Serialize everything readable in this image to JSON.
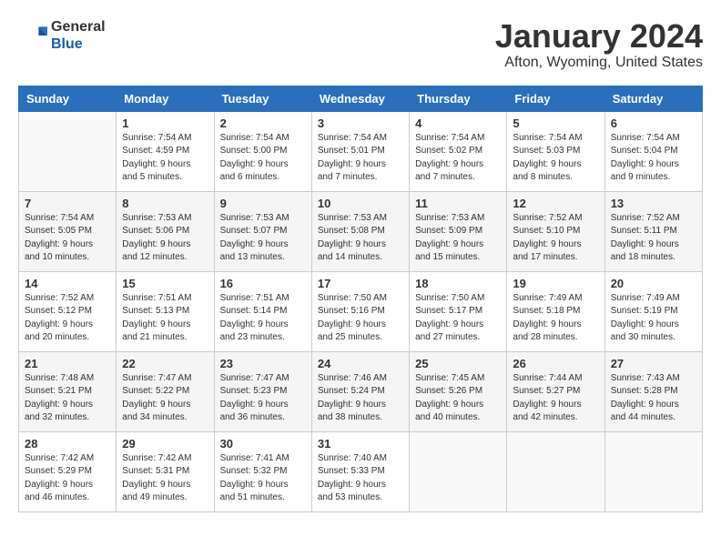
{
  "logo": {
    "line1": "General",
    "line2": "Blue"
  },
  "title": "January 2024",
  "location": "Afton, Wyoming, United States",
  "weekdays": [
    "Sunday",
    "Monday",
    "Tuesday",
    "Wednesday",
    "Thursday",
    "Friday",
    "Saturday"
  ],
  "weeks": [
    [
      {
        "day": "",
        "detail": ""
      },
      {
        "day": "1",
        "detail": "Sunrise: 7:54 AM\nSunset: 4:59 PM\nDaylight: 9 hours\nand 5 minutes."
      },
      {
        "day": "2",
        "detail": "Sunrise: 7:54 AM\nSunset: 5:00 PM\nDaylight: 9 hours\nand 6 minutes."
      },
      {
        "day": "3",
        "detail": "Sunrise: 7:54 AM\nSunset: 5:01 PM\nDaylight: 9 hours\nand 7 minutes."
      },
      {
        "day": "4",
        "detail": "Sunrise: 7:54 AM\nSunset: 5:02 PM\nDaylight: 9 hours\nand 7 minutes."
      },
      {
        "day": "5",
        "detail": "Sunrise: 7:54 AM\nSunset: 5:03 PM\nDaylight: 9 hours\nand 8 minutes."
      },
      {
        "day": "6",
        "detail": "Sunrise: 7:54 AM\nSunset: 5:04 PM\nDaylight: 9 hours\nand 9 minutes."
      }
    ],
    [
      {
        "day": "7",
        "detail": "Sunrise: 7:54 AM\nSunset: 5:05 PM\nDaylight: 9 hours\nand 10 minutes."
      },
      {
        "day": "8",
        "detail": "Sunrise: 7:53 AM\nSunset: 5:06 PM\nDaylight: 9 hours\nand 12 minutes."
      },
      {
        "day": "9",
        "detail": "Sunrise: 7:53 AM\nSunset: 5:07 PM\nDaylight: 9 hours\nand 13 minutes."
      },
      {
        "day": "10",
        "detail": "Sunrise: 7:53 AM\nSunset: 5:08 PM\nDaylight: 9 hours\nand 14 minutes."
      },
      {
        "day": "11",
        "detail": "Sunrise: 7:53 AM\nSunset: 5:09 PM\nDaylight: 9 hours\nand 15 minutes."
      },
      {
        "day": "12",
        "detail": "Sunrise: 7:52 AM\nSunset: 5:10 PM\nDaylight: 9 hours\nand 17 minutes."
      },
      {
        "day": "13",
        "detail": "Sunrise: 7:52 AM\nSunset: 5:11 PM\nDaylight: 9 hours\nand 18 minutes."
      }
    ],
    [
      {
        "day": "14",
        "detail": "Sunrise: 7:52 AM\nSunset: 5:12 PM\nDaylight: 9 hours\nand 20 minutes."
      },
      {
        "day": "15",
        "detail": "Sunrise: 7:51 AM\nSunset: 5:13 PM\nDaylight: 9 hours\nand 21 minutes."
      },
      {
        "day": "16",
        "detail": "Sunrise: 7:51 AM\nSunset: 5:14 PM\nDaylight: 9 hours\nand 23 minutes."
      },
      {
        "day": "17",
        "detail": "Sunrise: 7:50 AM\nSunset: 5:16 PM\nDaylight: 9 hours\nand 25 minutes."
      },
      {
        "day": "18",
        "detail": "Sunrise: 7:50 AM\nSunset: 5:17 PM\nDaylight: 9 hours\nand 27 minutes."
      },
      {
        "day": "19",
        "detail": "Sunrise: 7:49 AM\nSunset: 5:18 PM\nDaylight: 9 hours\nand 28 minutes."
      },
      {
        "day": "20",
        "detail": "Sunrise: 7:49 AM\nSunset: 5:19 PM\nDaylight: 9 hours\nand 30 minutes."
      }
    ],
    [
      {
        "day": "21",
        "detail": "Sunrise: 7:48 AM\nSunset: 5:21 PM\nDaylight: 9 hours\nand 32 minutes."
      },
      {
        "day": "22",
        "detail": "Sunrise: 7:47 AM\nSunset: 5:22 PM\nDaylight: 9 hours\nand 34 minutes."
      },
      {
        "day": "23",
        "detail": "Sunrise: 7:47 AM\nSunset: 5:23 PM\nDaylight: 9 hours\nand 36 minutes."
      },
      {
        "day": "24",
        "detail": "Sunrise: 7:46 AM\nSunset: 5:24 PM\nDaylight: 9 hours\nand 38 minutes."
      },
      {
        "day": "25",
        "detail": "Sunrise: 7:45 AM\nSunset: 5:26 PM\nDaylight: 9 hours\nand 40 minutes."
      },
      {
        "day": "26",
        "detail": "Sunrise: 7:44 AM\nSunset: 5:27 PM\nDaylight: 9 hours\nand 42 minutes."
      },
      {
        "day": "27",
        "detail": "Sunrise: 7:43 AM\nSunset: 5:28 PM\nDaylight: 9 hours\nand 44 minutes."
      }
    ],
    [
      {
        "day": "28",
        "detail": "Sunrise: 7:42 AM\nSunset: 5:29 PM\nDaylight: 9 hours\nand 46 minutes."
      },
      {
        "day": "29",
        "detail": "Sunrise: 7:42 AM\nSunset: 5:31 PM\nDaylight: 9 hours\nand 49 minutes."
      },
      {
        "day": "30",
        "detail": "Sunrise: 7:41 AM\nSunset: 5:32 PM\nDaylight: 9 hours\nand 51 minutes."
      },
      {
        "day": "31",
        "detail": "Sunrise: 7:40 AM\nSunset: 5:33 PM\nDaylight: 9 hours\nand 53 minutes."
      },
      {
        "day": "",
        "detail": ""
      },
      {
        "day": "",
        "detail": ""
      },
      {
        "day": "",
        "detail": ""
      }
    ]
  ]
}
